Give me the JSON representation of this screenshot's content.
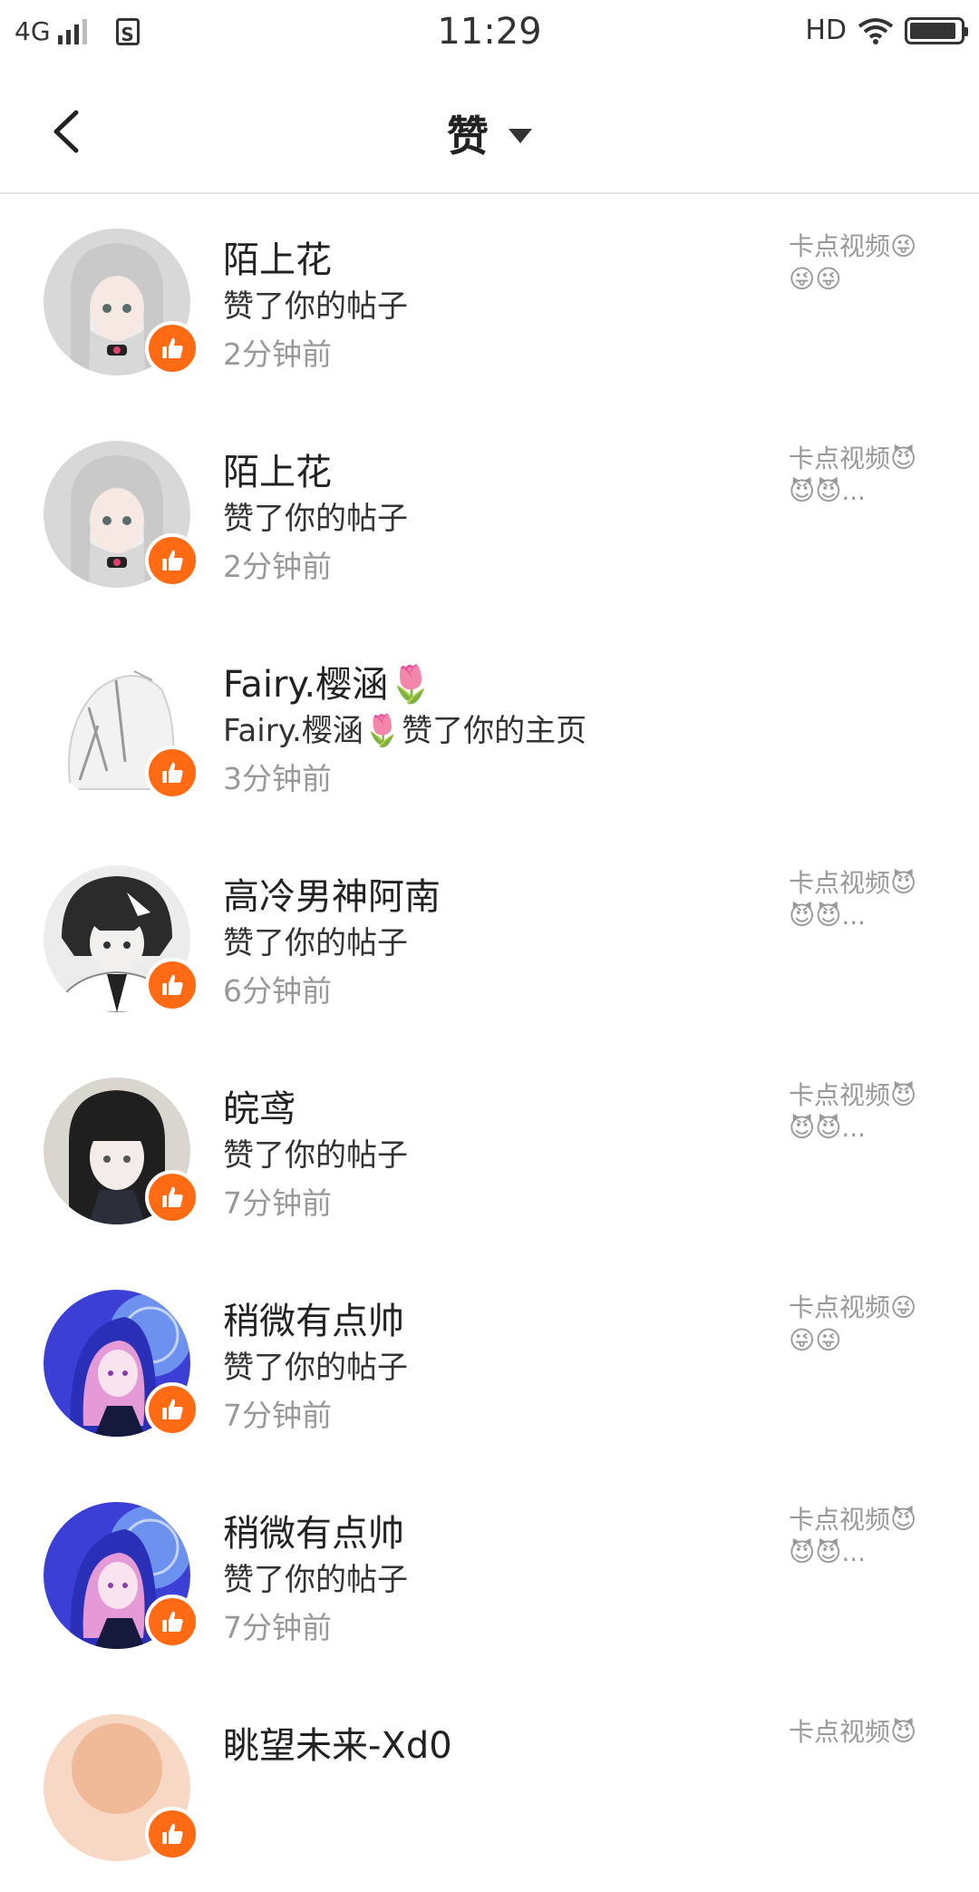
{
  "status_bar": {
    "network": "4G",
    "time": "11:29",
    "hd_label": "HD",
    "sim_label": "S"
  },
  "header": {
    "title": "赞",
    "back_icon": "chevron-left-icon",
    "dropdown_icon": "caret-down-icon"
  },
  "colors": {
    "badge": "#ff6a13",
    "secondary_text": "#999999"
  },
  "notifications": [
    {
      "name": "陌上花",
      "action": "赞了你的帖子",
      "time": "2分钟前",
      "preview": "卡点视频😜😜😜",
      "avatar": "avatar-silver-hair"
    },
    {
      "name": "陌上花",
      "action": "赞了你的帖子",
      "time": "2分钟前",
      "preview": "卡点视频😈😈😈...",
      "avatar": "avatar-silver-hair"
    },
    {
      "name": "Fairy.樱涵🌷",
      "action": "Fairy.樱涵🌷赞了你的主页",
      "time": "3分钟前",
      "preview": "",
      "avatar": "avatar-white-sketch"
    },
    {
      "name": "高冷男神阿南",
      "action": "赞了你的帖子",
      "time": "6分钟前",
      "preview": "卡点视频😈😈😈...",
      "avatar": "avatar-dark-boy"
    },
    {
      "name": "皖鸢",
      "action": "赞了你的帖子",
      "time": "7分钟前",
      "preview": "卡点视频😈😈😈...",
      "avatar": "avatar-black-hair"
    },
    {
      "name": "稍微有点帅",
      "action": "赞了你的帖子",
      "time": "7分钟前",
      "preview": "卡点视频😜😜😜",
      "avatar": "avatar-blue-pink"
    },
    {
      "name": "稍微有点帅",
      "action": "赞了你的帖子",
      "time": "7分钟前",
      "preview": "卡点视频😈😈😈...",
      "avatar": "avatar-blue-pink"
    },
    {
      "name": "眺望未来-Xd0",
      "action": "",
      "time": "",
      "preview": "卡点视频😈",
      "avatar": "avatar-peach"
    }
  ]
}
